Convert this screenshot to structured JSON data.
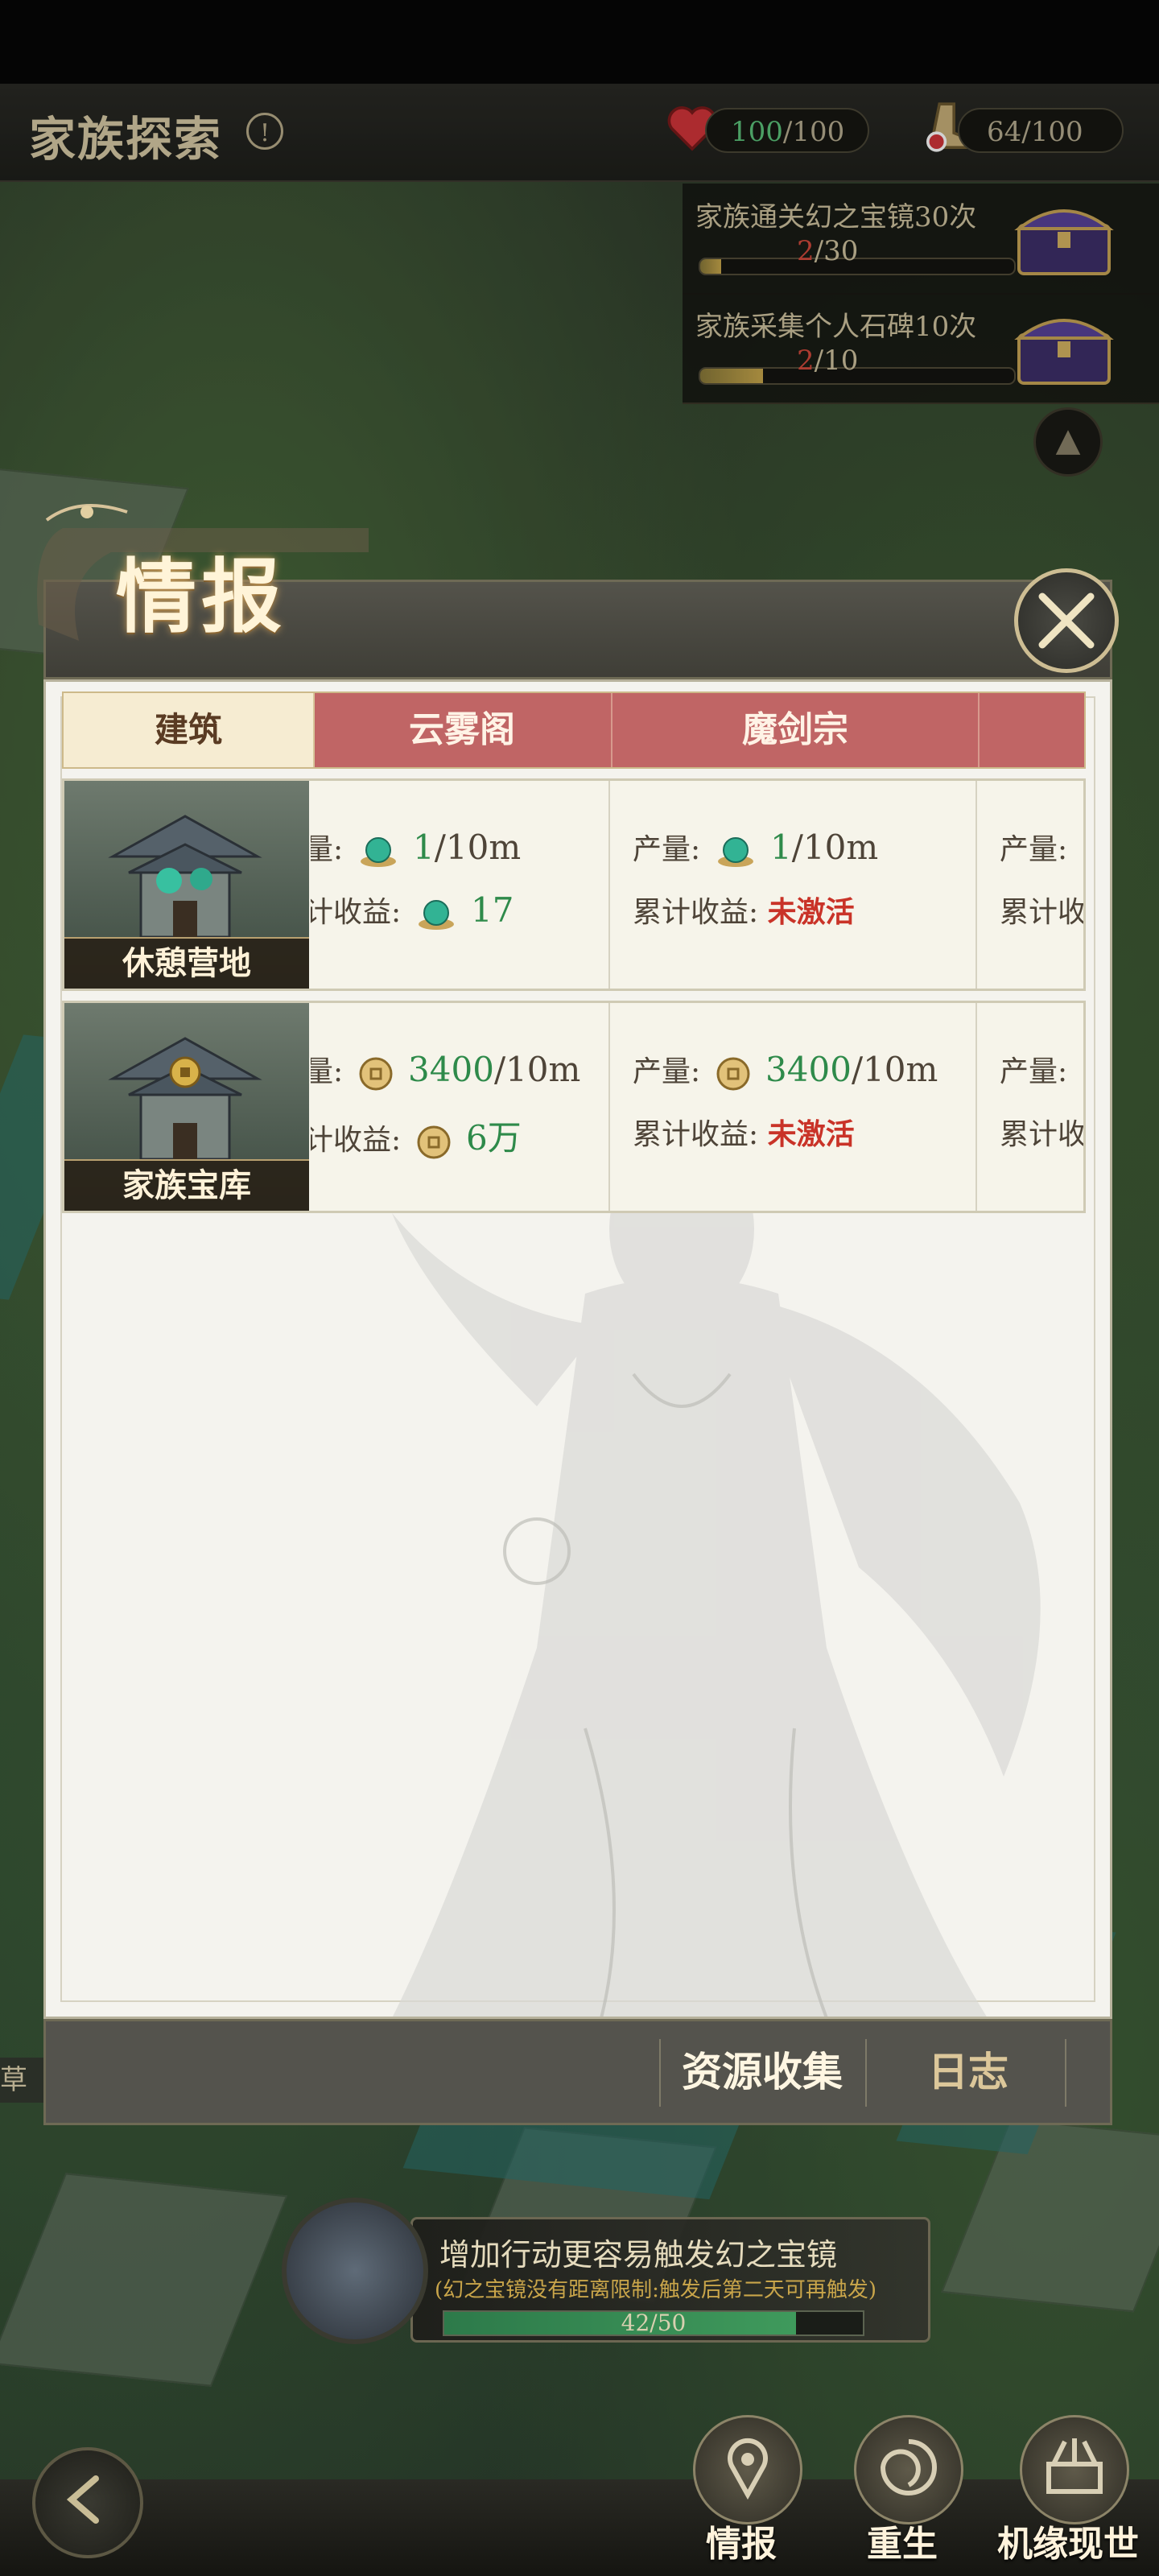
{
  "top_bar": {
    "title": "家族探索",
    "info_symbol": "!",
    "health": {
      "current": "100",
      "max": "/100"
    },
    "stamina": {
      "value": "64/100"
    }
  },
  "quests": [
    {
      "text": "家族通关幻之宝镜30次",
      "count_current": "2",
      "count_max": "/30",
      "progress": 0.067
    },
    {
      "text": "家族采集个人石碑10次",
      "count_current": "2",
      "count_max": "/10",
      "progress": 0.2
    }
  ],
  "modal": {
    "title": "情报",
    "table": {
      "header_building": "建筑",
      "columns": [
        "云雾阁",
        "魔剑宗"
      ],
      "rows": [
        {
          "name": "休憩营地",
          "cells": [
            {
              "line1_label": "量:",
              "rate_value": "1",
              "rate_unit": "/10m",
              "line2_label": "计收益:",
              "total": "17",
              "total_red": false
            },
            {
              "line1_label": "产量:",
              "rate_value": "1",
              "rate_unit": "/10m",
              "line2_label": "累计收益:",
              "total": "未激活",
              "total_red": true
            },
            {
              "line1_label": "产量:",
              "line2_label": "累计收"
            }
          ]
        },
        {
          "name": "家族宝库",
          "cells": [
            {
              "line1_label": "量:",
              "rate_value": "3400",
              "rate_unit": "/10m",
              "line2_label": "计收益:",
              "total": "6万",
              "total_red": false
            },
            {
              "line1_label": "产量:",
              "rate_value": "3400",
              "rate_unit": "/10m",
              "line2_label": "累计收益:",
              "total": "未激活",
              "total_red": true
            },
            {
              "line1_label": "产量:",
              "line2_label": "累计收"
            }
          ]
        }
      ]
    },
    "footer": {
      "collect_label": "资源收集",
      "log_label": "日志"
    }
  },
  "chat_symbol": "ooo",
  "side_label": "草丛",
  "event": {
    "title": "增加行动更容易触发幻之宝镜",
    "subtitle": "(幻之宝镜没有距离限制:触发后第二天可再触发)",
    "progress_text": "42/50",
    "progress": 0.84
  },
  "bottom_nav": [
    {
      "label": "情报"
    },
    {
      "label": "重生"
    },
    {
      "label": "机缘现世"
    }
  ],
  "colors": {
    "accent_red": "#c06565",
    "green": "#2e8a4a",
    "red": "#c93328"
  }
}
